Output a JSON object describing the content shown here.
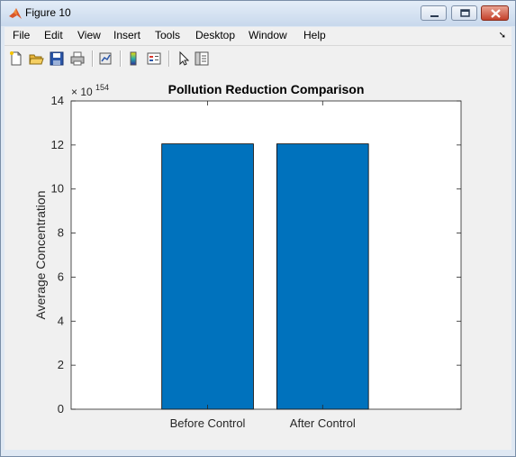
{
  "window": {
    "title": "Figure 10"
  },
  "menubar": {
    "items": [
      "File",
      "Edit",
      "View",
      "Insert",
      "Tools",
      "Desktop",
      "Window",
      "Help"
    ]
  },
  "toolbar": {
    "tools": [
      "new-figure-icon",
      "open-file-icon",
      "save-icon",
      "print-icon",
      "link-plot-icon",
      "colorbar-icon",
      "legend-icon",
      "pointer-icon",
      "property-inspector-icon"
    ]
  },
  "chart_data": {
    "type": "bar",
    "title": "Pollution Reduction Comparison",
    "xlabel": "",
    "ylabel": "Average Concentration",
    "categories": [
      "Before Control",
      "After Control"
    ],
    "values": [
      12.05,
      12.05
    ],
    "y_exponent_label": "× 10",
    "y_exponent": "154",
    "ylim": [
      0,
      14
    ],
    "yticks": [
      0,
      2,
      4,
      6,
      8,
      10,
      12,
      14
    ],
    "bar_color": "#0072BD",
    "grid": false
  }
}
